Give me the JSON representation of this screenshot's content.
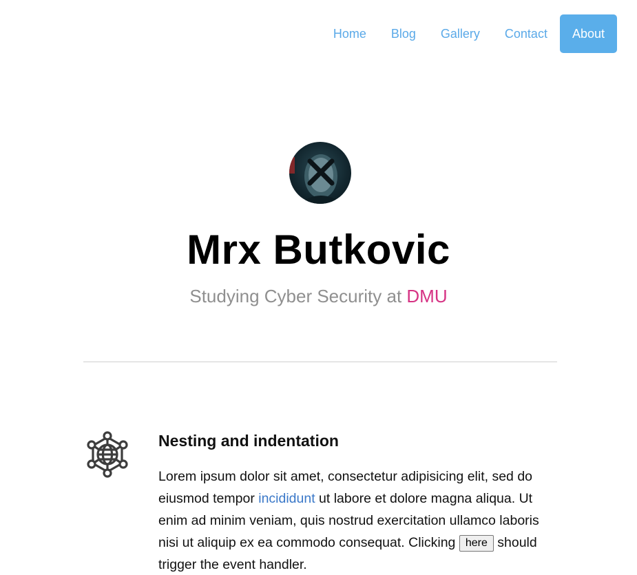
{
  "nav": {
    "items": [
      {
        "label": "Home"
      },
      {
        "label": "Blog"
      },
      {
        "label": "Gallery"
      },
      {
        "label": "Contact"
      },
      {
        "label": "About",
        "active": true
      }
    ]
  },
  "profile": {
    "name": "Mrx Butkovic",
    "subtitle_prefix": "Studying Cyber Security at ",
    "subtitle_highlight": "DMU"
  },
  "feature": {
    "icon": "network-globe-icon",
    "title": "Nesting and indentation",
    "text_part1": "Lorem ipsum dolor sit amet, consectetur adipisicing elit, sed do eiusmod tempor ",
    "link_text": "incididunt",
    "text_part2": " ut labore et dolore magna aliqua. Ut enim ad minim veniam, quis nostrud exercitation ullamco laboris nisi ut aliquip ex ea commodo consequat. Clicking ",
    "button_label": "here",
    "text_part3": " should trigger the event handler."
  },
  "colors": {
    "nav_link": "#5aa9e8",
    "nav_active_bg": "#5aaeea",
    "highlight": "#d63384",
    "link": "#3a78c8"
  }
}
